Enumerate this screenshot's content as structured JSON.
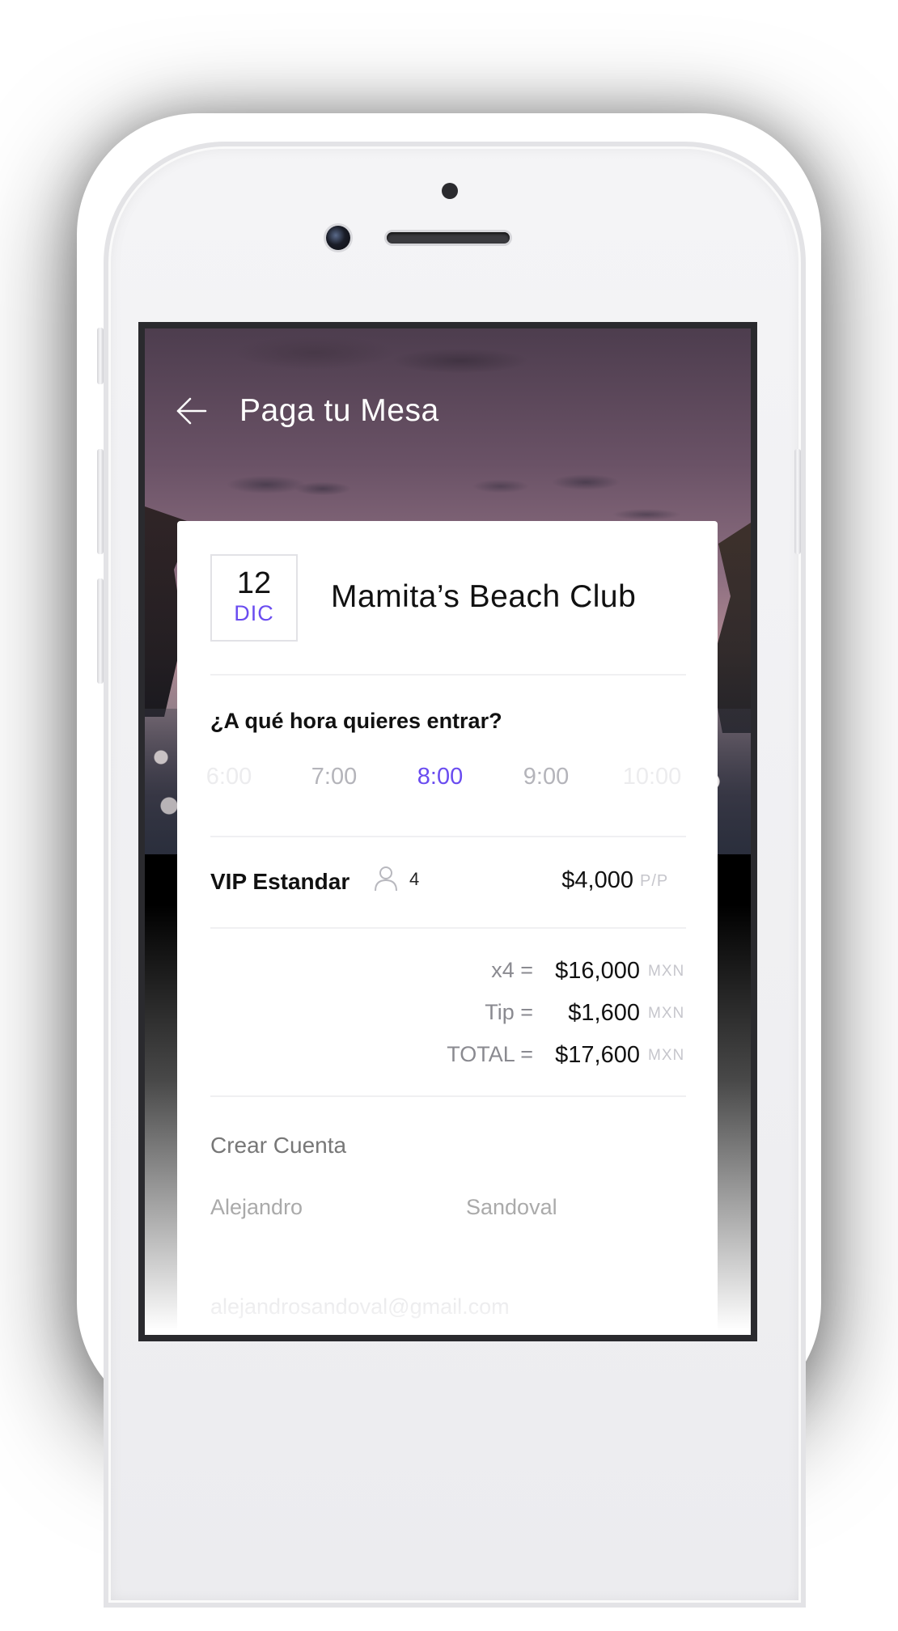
{
  "header": {
    "title": "Paga tu Mesa"
  },
  "event": {
    "day": "12",
    "month": "DIC",
    "venue": "Mamita’s Beach Club"
  },
  "time_picker": {
    "label": "¿A qué hora quieres entrar?",
    "options": [
      "6:00",
      "7:00",
      "8:00",
      "9:00",
      "10:00"
    ],
    "selected": "8:00"
  },
  "ticket": {
    "name": "VIP Estandar",
    "guests": "4",
    "price": "$4,000",
    "unit": "P/P"
  },
  "summary": {
    "rows": [
      {
        "label": "x4 =",
        "value": "$16,000",
        "unit": "MXN"
      },
      {
        "label": "Tip =",
        "value": "$1,600",
        "unit": "MXN"
      },
      {
        "label": "TOTAL =",
        "value": "$17,600",
        "unit": "MXN"
      }
    ]
  },
  "account": {
    "heading": "Crear Cuenta",
    "first_name": "Alejandro",
    "last_name": "Sandoval",
    "email": "alejandrosandoval@gmail.com"
  },
  "colors": {
    "accent": "#6a4cf0",
    "muted": "#c6c6cc"
  },
  "icons": {
    "back": "arrow-left-icon",
    "guests": "person-icon"
  }
}
